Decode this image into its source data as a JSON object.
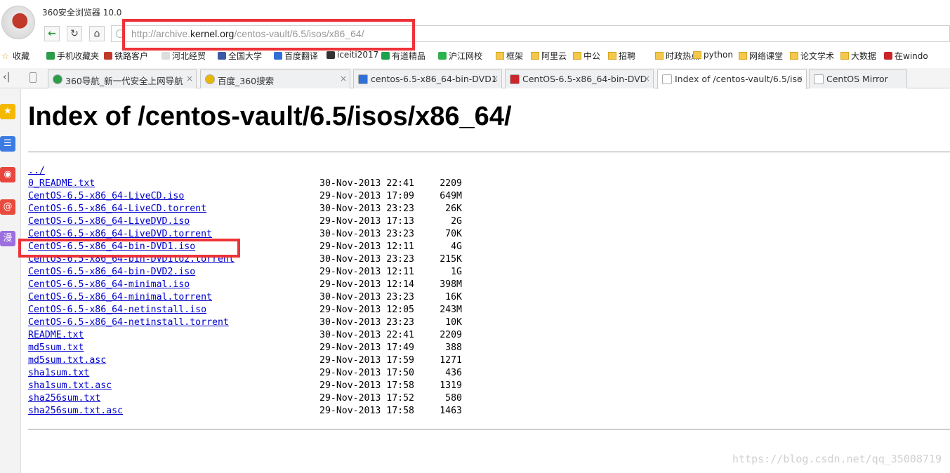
{
  "window": {
    "title": "360安全浏览器 10.0"
  },
  "address_bar": {
    "url_prefix": "http://archive.",
    "url_domain": "kernel.org",
    "url_path": "/centos-vault/6.5/isos/x86_64/"
  },
  "bookmarks": [
    {
      "label": "收藏",
      "icon": "star-icon"
    },
    {
      "label": "手机收藏夹",
      "icon": "phone-icon"
    },
    {
      "label": "铁路客户",
      "icon": "rail-icon"
    },
    {
      "label": "河北经贸",
      "icon": "page-icon"
    },
    {
      "label": "全国大学",
      "icon": "globe-icon"
    },
    {
      "label": "百度翻译",
      "icon": "translate-icon"
    },
    {
      "label": "iceiti2017",
      "icon": "github-icon"
    },
    {
      "label": "有道精品",
      "icon": "youdao-icon"
    },
    {
      "label": "沪江网校",
      "icon": "leaf-icon"
    },
    {
      "label": "框架",
      "icon": "folder-icon"
    },
    {
      "label": "阿里云",
      "icon": "folder-icon"
    },
    {
      "label": "中公",
      "icon": "folder-icon"
    },
    {
      "label": "招聘",
      "icon": "folder-icon"
    },
    {
      "label": "时政热点",
      "icon": "folder-icon"
    },
    {
      "label": "python",
      "icon": "folder-icon"
    },
    {
      "label": "网络课堂",
      "icon": "folder-icon"
    },
    {
      "label": "论文学术",
      "icon": "folder-icon"
    },
    {
      "label": "大数据",
      "icon": "folder-icon"
    },
    {
      "label": "在windo",
      "icon": "csdn-icon"
    }
  ],
  "tabs": [
    {
      "label": "360导航_新一代安全上网导航",
      "close": "×"
    },
    {
      "label": "百度_360搜索",
      "close": "×"
    },
    {
      "label": "centos-6.5-x86_64-bin-DVD1",
      "close": "×"
    },
    {
      "label": "CentOS-6.5-x86_64-bin-DVD",
      "close": "×"
    },
    {
      "label": "Index of /centos-vault/6.5/iso",
      "close": "×"
    },
    {
      "label": "CentOS Mirror",
      "close": ""
    }
  ],
  "sidebar": [
    {
      "icon": "favorites-star-icon",
      "color": "#f5b800",
      "glyph": "★"
    },
    {
      "icon": "news-icon",
      "color": "#3b7be3",
      "glyph": "☰"
    },
    {
      "icon": "weibo-icon",
      "color": "#e8453c",
      "glyph": "◉"
    },
    {
      "icon": "mail-icon",
      "color": "#e84b3c",
      "glyph": "@"
    },
    {
      "icon": "comic-icon",
      "color": "#9b6fe0",
      "glyph": "漫"
    }
  ],
  "page": {
    "heading": "Index of /centos-vault/6.5/isos/x86_64/",
    "parent_link": "../",
    "files": [
      {
        "name": "0_README.txt",
        "date": "30-Nov-2013 22:41",
        "size": "2209"
      },
      {
        "name": "CentOS-6.5-x86_64-LiveCD.iso",
        "date": "29-Nov-2013 17:09",
        "size": "649M"
      },
      {
        "name": "CentOS-6.5-x86_64-LiveCD.torrent",
        "date": "30-Nov-2013 23:23",
        "size": "26K"
      },
      {
        "name": "CentOS-6.5-x86_64-LiveDVD.iso",
        "date": "29-Nov-2013 17:13",
        "size": "2G"
      },
      {
        "name": "CentOS-6.5-x86_64-LiveDVD.torrent",
        "date": "30-Nov-2013 23:23",
        "size": "70K"
      },
      {
        "name": "CentOS-6.5-x86_64-bin-DVD1.iso",
        "date": "29-Nov-2013 12:11",
        "size": "4G"
      },
      {
        "name": "CentOS-6.5-x86_64-bin-DVD1to2.torrent",
        "date": "30-Nov-2013 23:23",
        "size": "215K"
      },
      {
        "name": "CentOS-6.5-x86_64-bin-DVD2.iso",
        "date": "29-Nov-2013 12:11",
        "size": "1G"
      },
      {
        "name": "CentOS-6.5-x86_64-minimal.iso",
        "date": "29-Nov-2013 12:14",
        "size": "398M"
      },
      {
        "name": "CentOS-6.5-x86_64-minimal.torrent",
        "date": "30-Nov-2013 23:23",
        "size": "16K"
      },
      {
        "name": "CentOS-6.5-x86_64-netinstall.iso",
        "date": "29-Nov-2013 12:05",
        "size": "243M"
      },
      {
        "name": "CentOS-6.5-x86_64-netinstall.torrent",
        "date": "30-Nov-2013 23:23",
        "size": "10K"
      },
      {
        "name": "README.txt",
        "date": "30-Nov-2013 22:41",
        "size": "2209"
      },
      {
        "name": "md5sum.txt",
        "date": "29-Nov-2013 17:49",
        "size": "388"
      },
      {
        "name": "md5sum.txt.asc",
        "date": "29-Nov-2013 17:59",
        "size": "1271"
      },
      {
        "name": "sha1sum.txt",
        "date": "29-Nov-2013 17:50",
        "size": "436"
      },
      {
        "name": "sha1sum.txt.asc",
        "date": "29-Nov-2013 17:58",
        "size": "1319"
      },
      {
        "name": "sha256sum.txt",
        "date": "29-Nov-2013 17:52",
        "size": "580"
      },
      {
        "name": "sha256sum.txt.asc",
        "date": "29-Nov-2013 17:58",
        "size": "1463"
      }
    ]
  },
  "watermark": "https://blog.csdn.net/qq_35008719",
  "colors": {
    "link": "#0000cc",
    "highlight": "#ee3338"
  }
}
